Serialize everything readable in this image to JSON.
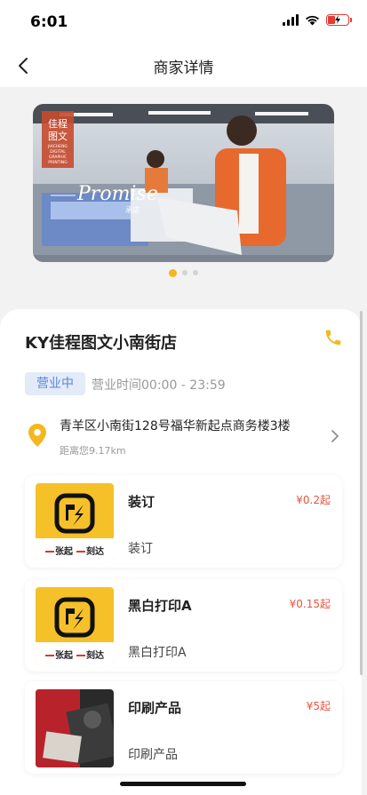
{
  "status_bar": {
    "time": "6:01"
  },
  "nav": {
    "title": "商家详情"
  },
  "banner": {
    "logo_lines": [
      "佳程",
      "图文"
    ],
    "logo_sub_lines": [
      "JIACHENG",
      "DIGITAL",
      "GRAPHIC",
      "PRINTING"
    ],
    "overlay_text": "Promise",
    "overlay_sub": "承诺",
    "slide_count": 3,
    "active_slide": 1
  },
  "store": {
    "name": "KY佳程图文小南街店",
    "status_badge": "营业中",
    "hours": "营业时间00:00 - 23:59",
    "address": "青羊区小南街128号福华新起点商务楼3楼",
    "distance": "距离您9.17km"
  },
  "products": [
    {
      "title": "装订",
      "subtitle": "装订",
      "price": "¥0.2起",
      "image": "logo-print-icon"
    },
    {
      "title": "黑白打印A",
      "subtitle": "黑白打印A",
      "price": "¥0.15起",
      "image": "logo-print-icon"
    },
    {
      "title": "印刷产品",
      "subtitle": "印刷产品",
      "price": "¥5起",
      "image": "printed-photo"
    }
  ],
  "logo_slogan": [
    "张起",
    "刻达"
  ],
  "colors": {
    "accent": "#f4b71e",
    "price": "#e5553e",
    "badge_bg": "#e3ebf9",
    "badge_text": "#5b86d6"
  }
}
